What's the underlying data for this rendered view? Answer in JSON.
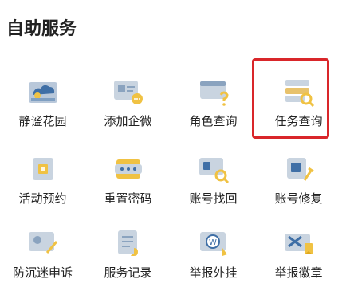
{
  "header": {
    "title": "自助服务"
  },
  "highlight_color": "#d9262a",
  "items": [
    {
      "label": "静谧花园",
      "icon": "garden-cloud-icon"
    },
    {
      "label": "添加企微",
      "icon": "add-wecom-icon"
    },
    {
      "label": "角色查询",
      "icon": "role-query-icon"
    },
    {
      "label": "任务查询",
      "icon": "task-query-icon",
      "highlighted": true
    },
    {
      "label": "活动预约",
      "icon": "event-reservation-icon"
    },
    {
      "label": "重置密码",
      "icon": "reset-password-icon"
    },
    {
      "label": "账号找回",
      "icon": "account-recovery-icon"
    },
    {
      "label": "账号修复",
      "icon": "account-repair-icon"
    },
    {
      "label": "防沉迷申诉",
      "icon": "anti-addiction-appeal-icon"
    },
    {
      "label": "服务记录",
      "icon": "service-record-icon"
    },
    {
      "label": "举报外挂",
      "icon": "report-cheat-icon"
    },
    {
      "label": "举报徽章",
      "icon": "report-badge-icon"
    }
  ]
}
